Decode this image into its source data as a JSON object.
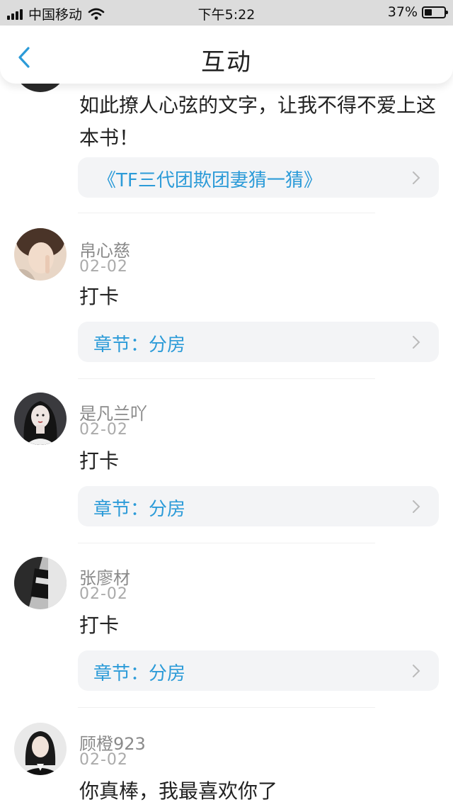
{
  "status_bar": {
    "carrier": "中国移动",
    "time": "下午5:22",
    "battery_percent": "37%",
    "battery_level": 0.37
  },
  "nav": {
    "title": "互动"
  },
  "first_comment": {
    "text": "如此撩人心弦的文字，让我不得不爱上这本书！",
    "book_link": "《TF三代团欺团妻猜一猜》"
  },
  "comments": [
    {
      "name": "帛心慈",
      "date": "02-02",
      "text": "打卡",
      "chapter": "章节：分房"
    },
    {
      "name": "是凡兰吖",
      "date": "02-02",
      "text": "打卡",
      "chapter": "章节：分房"
    },
    {
      "name": "张廖材",
      "date": "02-02",
      "text": "打卡",
      "chapter": "章节：分房"
    },
    {
      "name": "顾橙923",
      "date": "02-02",
      "text": "你真棒，我最喜欢你了"
    }
  ],
  "colors": {
    "accent": "#2c9bd8",
    "status_bar_bg": "#dcdcdc",
    "chapter_bg": "#f3f4f6"
  }
}
